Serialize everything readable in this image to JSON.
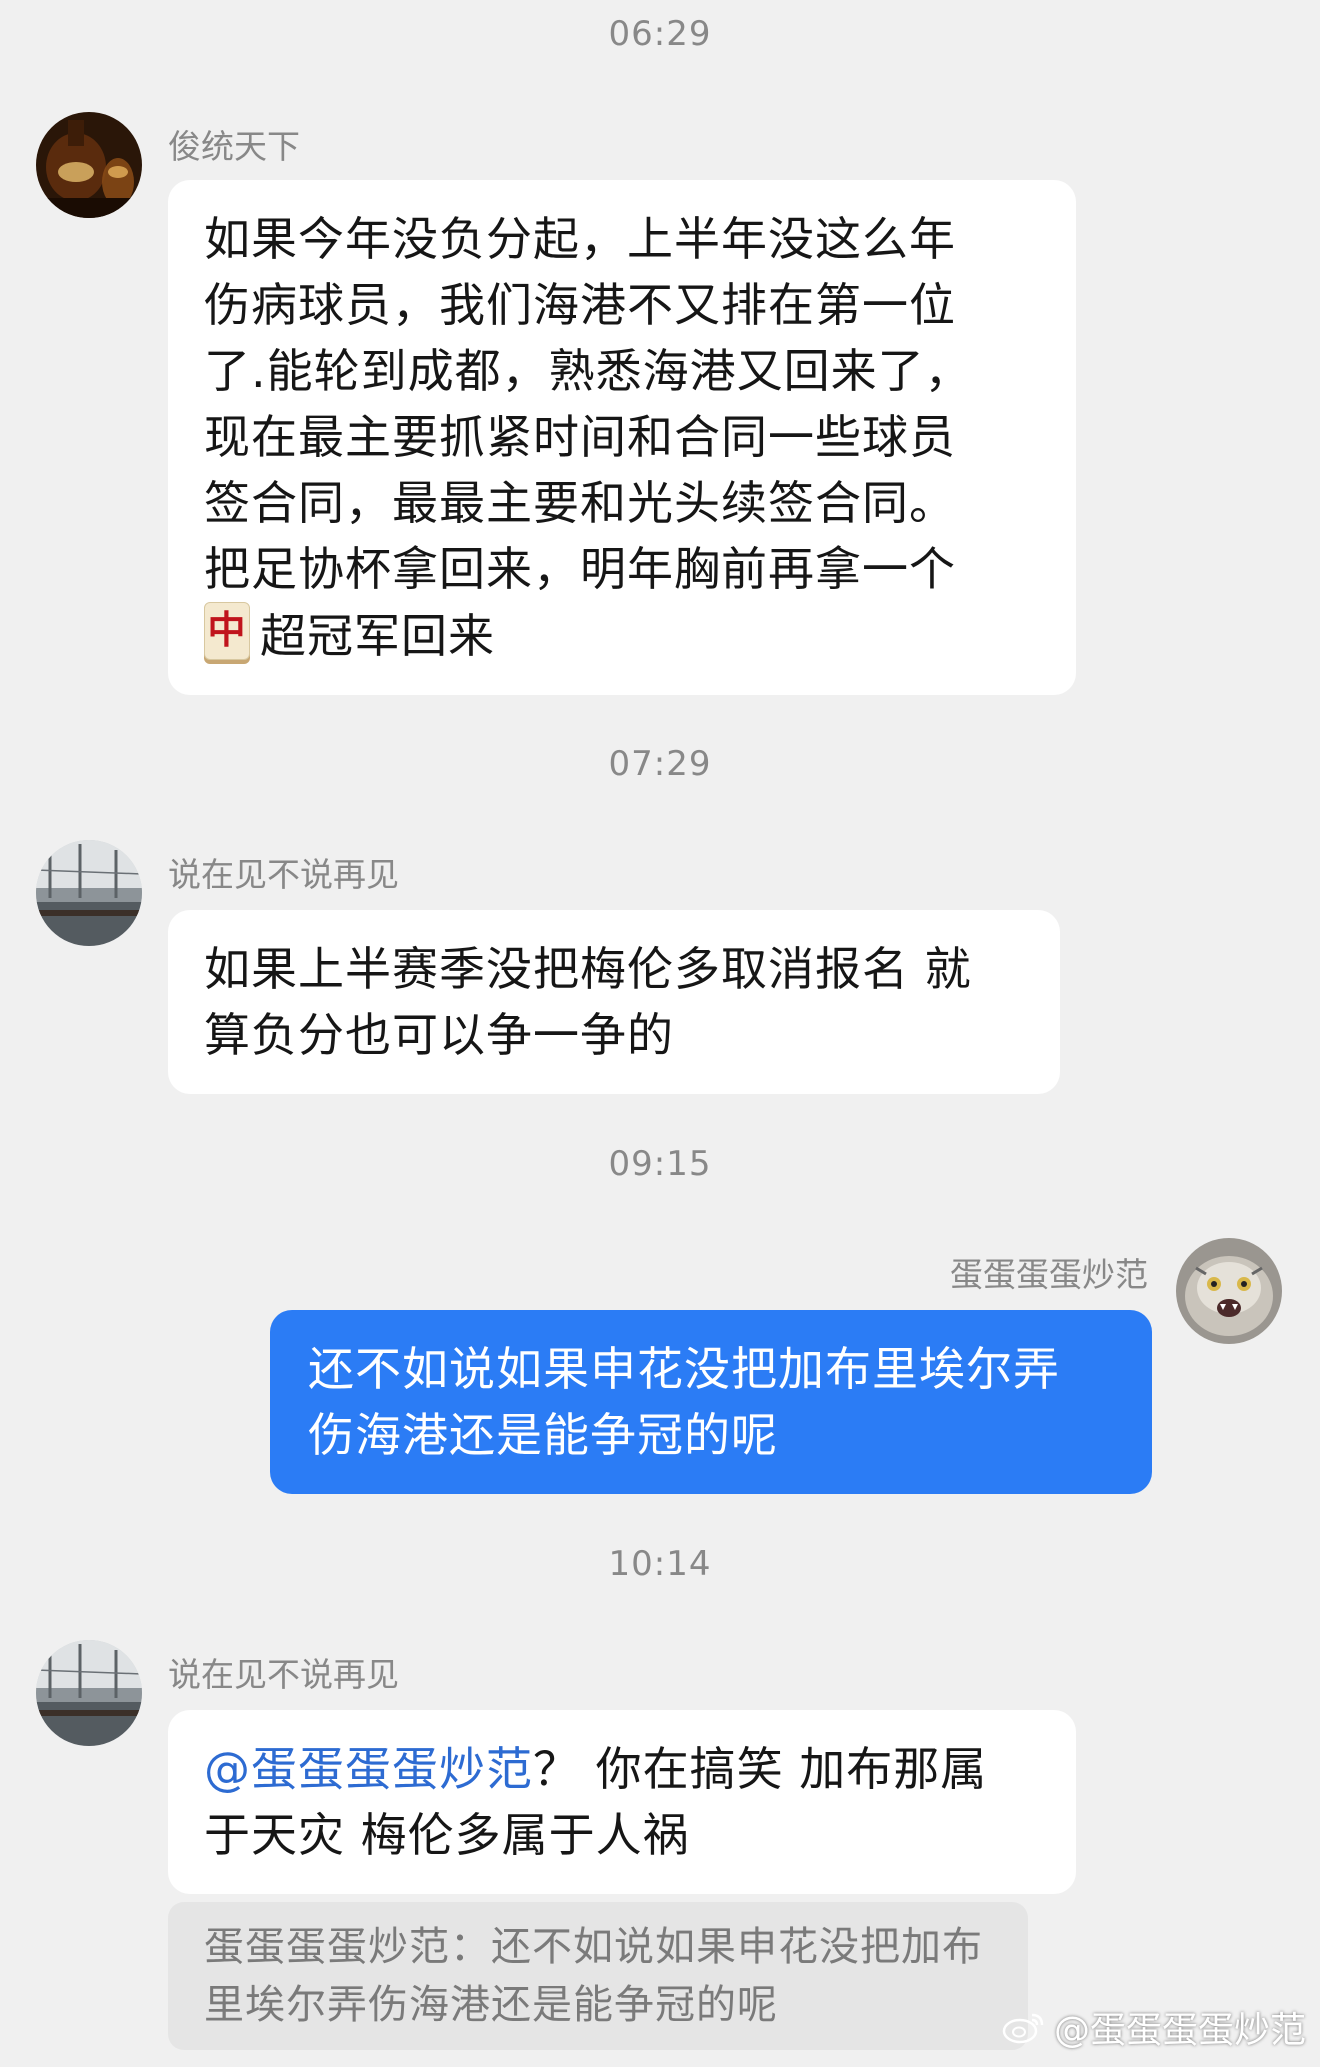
{
  "timestamps": [
    "06:29",
    "07:29",
    "09:15",
    "10:14"
  ],
  "messages": [
    {
      "sender": "俊统天下",
      "lines": [
        "如果今年没负分起，上半年没这么年",
        "伤病球员，我们海港不又排在第一位",
        "了.能轮到成都，熟悉海港又回来了，",
        "现在最主要抓紧时间和合同一些球员",
        "签合同，最最主要和光头续签合同。",
        "把足协杯拿回来，明年胸前再拿一个"
      ],
      "emoji_glyph": "中",
      "last_line": "超冠军回来"
    },
    {
      "sender": "说在见不说再见",
      "lines": [
        "如果上半赛季没把梅伦多取消报名 就",
        "算负分也可以争一争的"
      ]
    },
    {
      "sender": "蛋蛋蛋蛋炒范",
      "lines": [
        "还不如说如果申花没把加布里埃尔弄",
        "伤海港还是能争冠的呢"
      ]
    },
    {
      "sender": "说在见不说再见",
      "mention": "@蛋蛋蛋蛋炒范",
      "first_line_rest": "？ 你在搞笑 加布那属",
      "lines": [
        "于天灾 梅伦多属于人祸"
      ],
      "quote_lines": [
        "蛋蛋蛋蛋炒范：还不如说如果申花没把加布",
        "里埃尔弄伤海港还是能争冠的呢"
      ]
    }
  ],
  "watermark": "@蛋蛋蛋蛋炒范",
  "colors": {
    "background": "#f0f0f0",
    "incoming_bubble": "#ffffff",
    "outgoing_bubble": "#2b7cf5",
    "mention": "#2d6bd2",
    "timestamp": "#888888"
  }
}
